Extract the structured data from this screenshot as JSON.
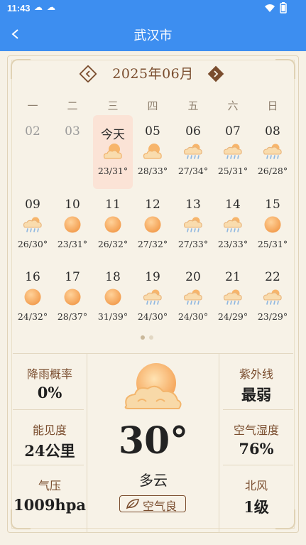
{
  "status_bar": {
    "time": "11:43"
  },
  "header": {
    "title": "武汉市"
  },
  "calendar": {
    "month_label": "2025年06月",
    "weekdays": [
      "一",
      "二",
      "三",
      "四",
      "五",
      "六",
      "日"
    ],
    "days": [
      {
        "num": "02",
        "temp": "",
        "icon": "none",
        "dim": true
      },
      {
        "num": "03",
        "temp": "",
        "icon": "none",
        "dim": true
      },
      {
        "num": "今天",
        "temp": "23/31°",
        "icon": "cloudy"
      },
      {
        "num": "05",
        "temp": "28/33°",
        "icon": "cloudy"
      },
      {
        "num": "06",
        "temp": "27/34°",
        "icon": "rain"
      },
      {
        "num": "07",
        "temp": "25/31°",
        "icon": "rain"
      },
      {
        "num": "08",
        "temp": "26/28°",
        "icon": "rain"
      },
      {
        "num": "09",
        "temp": "26/30°",
        "icon": "rain"
      },
      {
        "num": "10",
        "temp": "23/31°",
        "icon": "sun"
      },
      {
        "num": "11",
        "temp": "26/32°",
        "icon": "sun"
      },
      {
        "num": "12",
        "temp": "27/32°",
        "icon": "sun"
      },
      {
        "num": "13",
        "temp": "27/33°",
        "icon": "rain"
      },
      {
        "num": "14",
        "temp": "23/33°",
        "icon": "rain"
      },
      {
        "num": "15",
        "temp": "25/31°",
        "icon": "sun"
      },
      {
        "num": "16",
        "temp": "24/32°",
        "icon": "sun"
      },
      {
        "num": "17",
        "temp": "28/37°",
        "icon": "sun"
      },
      {
        "num": "18",
        "temp": "31/39°",
        "icon": "sun"
      },
      {
        "num": "19",
        "temp": "24/30°",
        "icon": "rain"
      },
      {
        "num": "20",
        "temp": "24/30°",
        "icon": "rain"
      },
      {
        "num": "21",
        "temp": "24/29°",
        "icon": "rain"
      },
      {
        "num": "22",
        "temp": "23/29°",
        "icon": "rain"
      }
    ],
    "page_count": 2,
    "active_page": 0
  },
  "details": {
    "rain_prob": {
      "label": "降雨概率",
      "value": "0%"
    },
    "visibility": {
      "label": "能见度",
      "value": "24公里"
    },
    "pressure": {
      "label": "气压",
      "value": "1009hpa"
    },
    "uv": {
      "label": "紫外线",
      "value": "最弱"
    },
    "humidity": {
      "label": "空气湿度",
      "value": "76%"
    },
    "wind": {
      "label": "北风",
      "value": "1级"
    },
    "current_temp": "30°",
    "condition": "多云",
    "aqi_label": "空气良",
    "current_icon": "cloudy"
  },
  "colors": {
    "accent": "#3d8ef0",
    "brown": "#7a4d2e",
    "sun": "#f5a55a"
  }
}
